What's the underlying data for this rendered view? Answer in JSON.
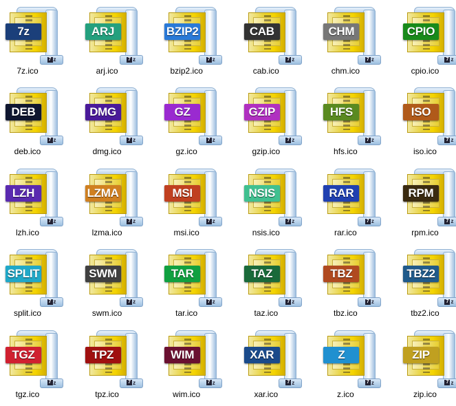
{
  "files": [
    {
      "name": "7z.ico",
      "badge": "7z",
      "color": "#1b3f7a"
    },
    {
      "name": "arj.ico",
      "badge": "ARJ",
      "color": "#24a07e"
    },
    {
      "name": "bzip2.ico",
      "badge": "BZIP2",
      "color": "#2a7ad8"
    },
    {
      "name": "cab.ico",
      "badge": "CAB",
      "color": "#333333"
    },
    {
      "name": "chm.ico",
      "badge": "CHM",
      "color": "#777777"
    },
    {
      "name": "cpio.ico",
      "badge": "CPIO",
      "color": "#188a1a"
    },
    {
      "name": "deb.ico",
      "badge": "DEB",
      "color": "#0f1630"
    },
    {
      "name": "dmg.ico",
      "badge": "DMG",
      "color": "#4a1a9a"
    },
    {
      "name": "gz.ico",
      "badge": "GZ",
      "color": "#9a2ad0"
    },
    {
      "name": "gzip.ico",
      "badge": "GZIP",
      "color": "#b030c0"
    },
    {
      "name": "hfs.ico",
      "badge": "HFS",
      "color": "#5a8a20"
    },
    {
      "name": "iso.ico",
      "badge": "ISO",
      "color": "#b05a1a"
    },
    {
      "name": "lzh.ico",
      "badge": "LZH",
      "color": "#5a2ab0"
    },
    {
      "name": "lzma.ico",
      "badge": "LZMA",
      "color": "#d08020"
    },
    {
      "name": "msi.ico",
      "badge": "MSI",
      "color": "#c04020"
    },
    {
      "name": "nsis.ico",
      "badge": "NSIS",
      "color": "#40c090"
    },
    {
      "name": "rar.ico",
      "badge": "RAR",
      "color": "#2040b0"
    },
    {
      "name": "rpm.ico",
      "badge": "RPM",
      "color": "#3a2a10"
    },
    {
      "name": "split.ico",
      "badge": "SPLIT",
      "color": "#20a8c8"
    },
    {
      "name": "swm.ico",
      "badge": "SWM",
      "color": "#404040"
    },
    {
      "name": "tar.ico",
      "badge": "TAR",
      "color": "#10a040"
    },
    {
      "name": "taz.ico",
      "badge": "TAZ",
      "color": "#1a6a3a"
    },
    {
      "name": "tbz.ico",
      "badge": "TBZ",
      "color": "#b04a20"
    },
    {
      "name": "tbz2.ico",
      "badge": "TBZ2",
      "color": "#205a8a"
    },
    {
      "name": "tgz.ico",
      "badge": "TGZ",
      "color": "#d02030"
    },
    {
      "name": "tpz.ico",
      "badge": "TPZ",
      "color": "#a01010"
    },
    {
      "name": "wim.ico",
      "badge": "WIM",
      "color": "#6a1030"
    },
    {
      "name": "xar.ico",
      "badge": "XAR",
      "color": "#1a4a8a"
    },
    {
      "name": "z.ico",
      "badge": "Z",
      "color": "#2090d0"
    },
    {
      "name": "zip.ico",
      "badge": "ZIP",
      "color": "#c0a020"
    }
  ],
  "mini_badge": "7z"
}
